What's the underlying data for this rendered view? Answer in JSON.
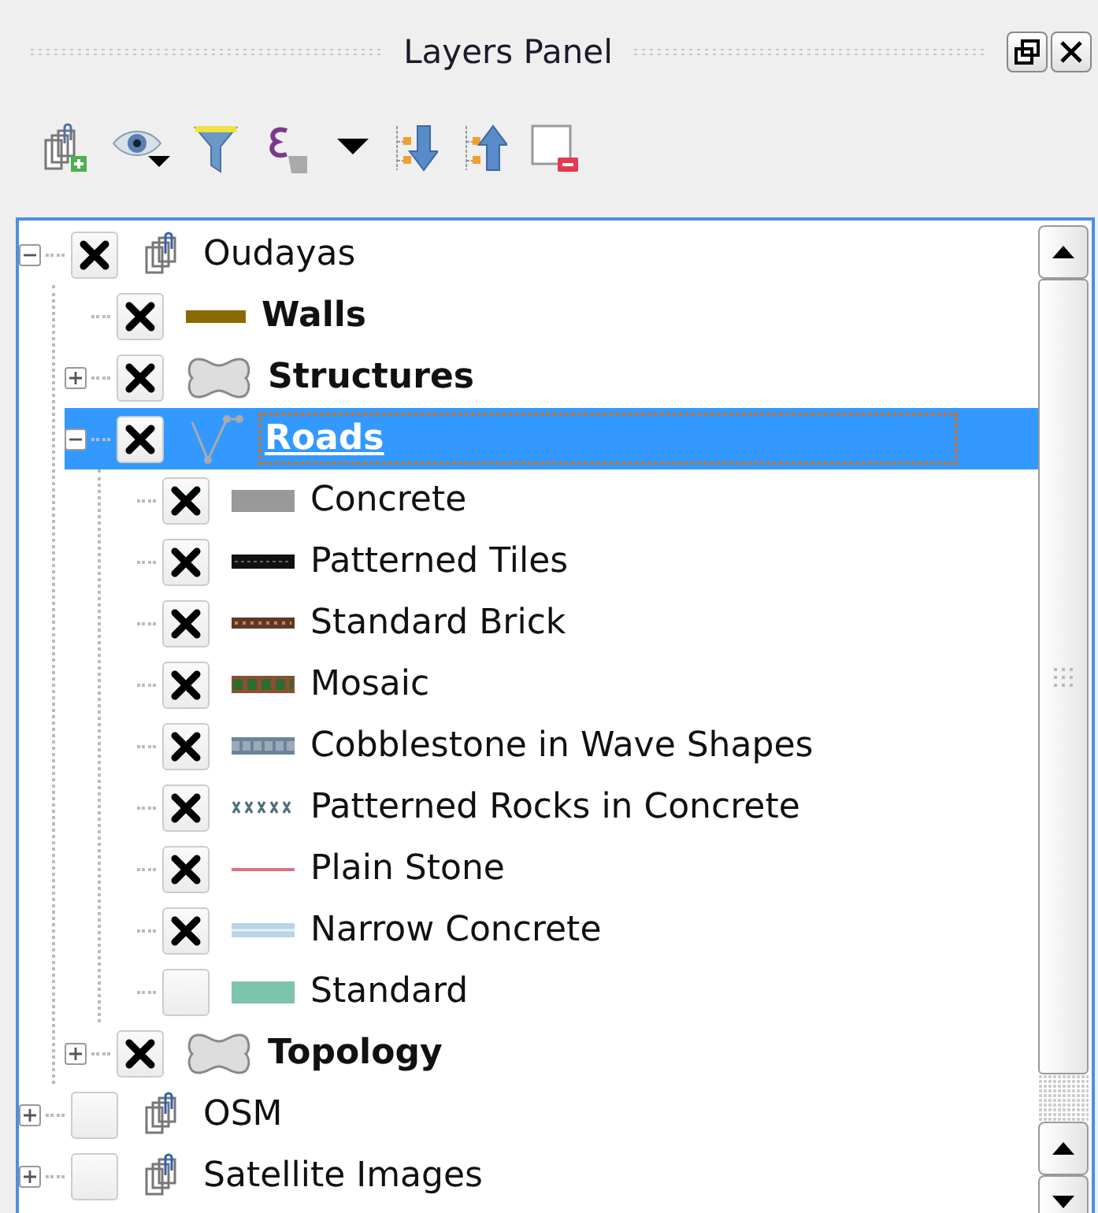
{
  "panel": {
    "title": "Layers Panel"
  },
  "tree": [
    {
      "kind": "group",
      "name": "Oudayas",
      "checked": true,
      "expanded": true,
      "selected": false,
      "children": [
        {
          "kind": "line",
          "color": "#8a6a00",
          "name": "Walls",
          "checked": true,
          "selected": false
        },
        {
          "kind": "polygon",
          "name": "Structures",
          "checked": true,
          "expanded": false,
          "selected": false
        },
        {
          "kind": "vertex",
          "name": "Roads",
          "checked": true,
          "expanded": true,
          "selected": true,
          "children": [
            {
              "kind": "solid",
              "color": "#999999",
              "name": "Concrete",
              "checked": true,
              "selected": false
            },
            {
              "kind": "tiles",
              "color": "#111111",
              "name": "Patterned Tiles",
              "checked": true,
              "selected": false
            },
            {
              "kind": "brick",
              "color": "#5a3a2a",
              "name": "Standard Brick",
              "checked": true,
              "selected": false
            },
            {
              "kind": "mosaic",
              "color": "#2f6b2f",
              "name": "Mosaic",
              "checked": true,
              "selected": false
            },
            {
              "kind": "cobble",
              "color": "#6b8499",
              "name": "Cobblestone in Wave Shapes",
              "checked": true,
              "selected": false
            },
            {
              "kind": "cross",
              "color": "#4f6f80",
              "name": "Patterned Rocks in Concrete",
              "checked": true,
              "selected": false
            },
            {
              "kind": "thin",
              "color": "#e07080",
              "name": "Plain Stone",
              "checked": true,
              "selected": false
            },
            {
              "kind": "double",
              "color": "#b8d4e6",
              "name": "Narrow Concrete",
              "checked": true,
              "selected": false
            },
            {
              "kind": "solid",
              "color": "#7cc4aa",
              "name": "Standard",
              "checked": false,
              "selected": false
            }
          ]
        },
        {
          "kind": "polygon",
          "name": "Topology",
          "checked": true,
          "expanded": false,
          "selected": false
        }
      ]
    },
    {
      "kind": "group",
      "name": "OSM",
      "checked": false,
      "expanded": false,
      "selected": false
    },
    {
      "kind": "group",
      "name": "Satellite Images",
      "checked": false,
      "expanded": false,
      "selected": false
    }
  ]
}
